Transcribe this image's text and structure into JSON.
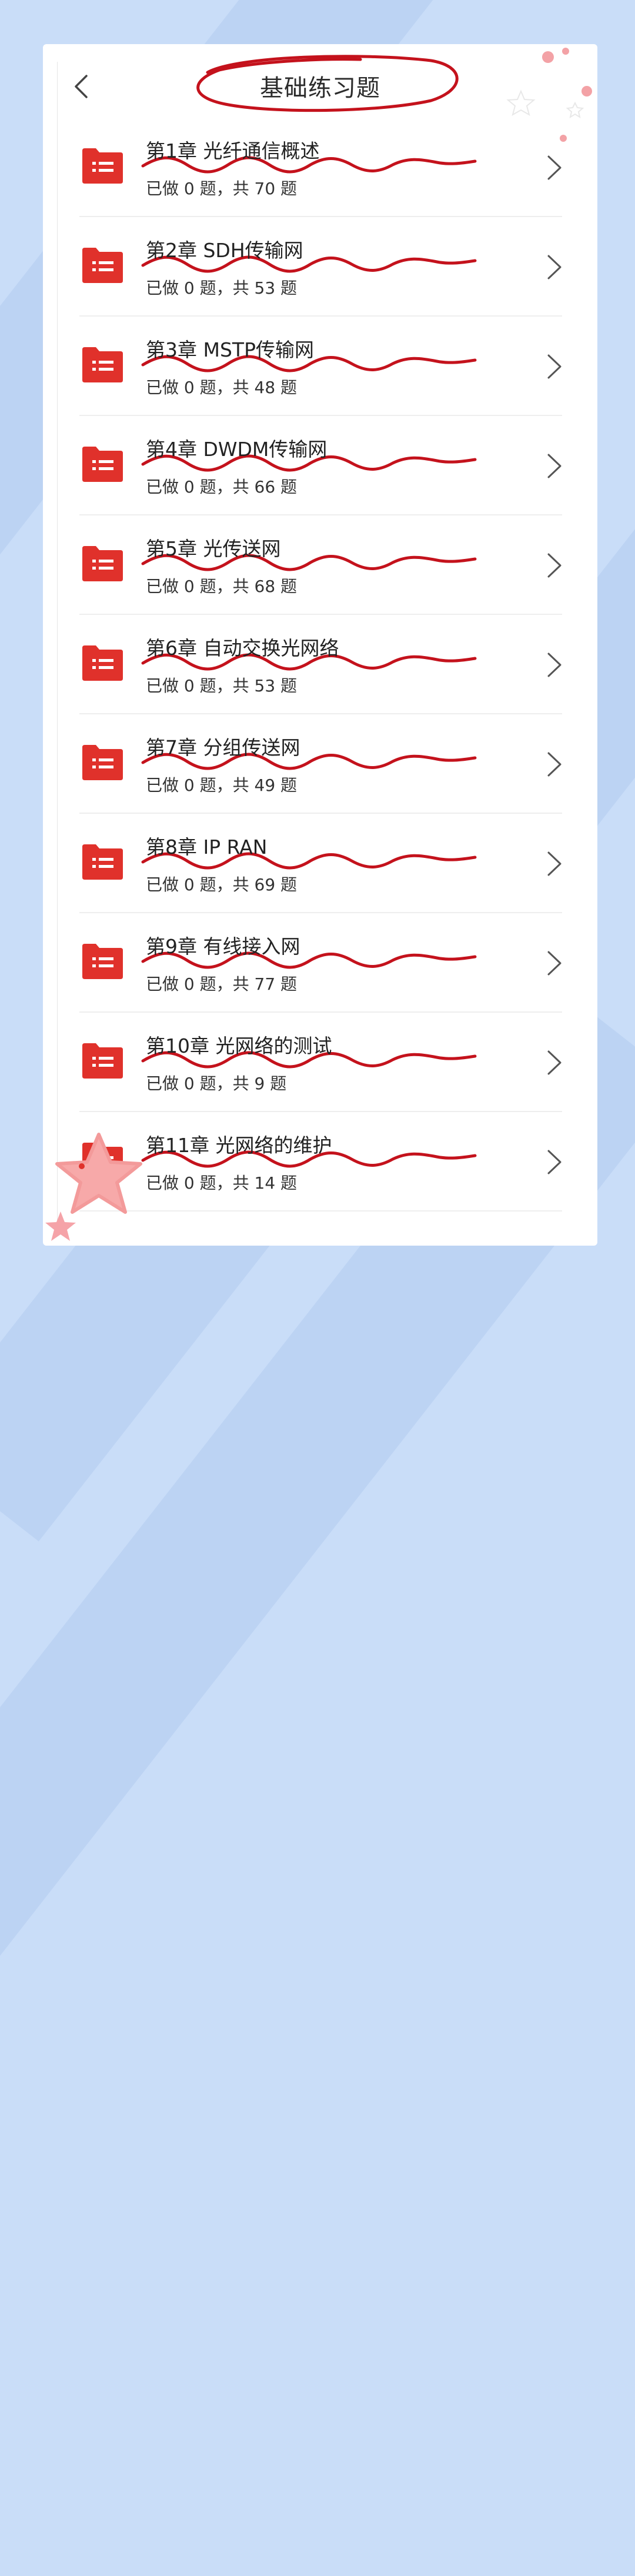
{
  "header": {
    "title": "基础练习题",
    "back_icon": "chevron-left-icon"
  },
  "theme": {
    "accent": "#e0312b",
    "annotation": "#c4121c",
    "background": "#c9ddf8"
  },
  "chapters": [
    {
      "title": "第1章 光纤通信概述",
      "progress": "已做 0 题，共 70 题"
    },
    {
      "title": "第2章 SDH传输网",
      "progress": "已做 0 题，共 53 题"
    },
    {
      "title": "第3章 MSTP传输网",
      "progress": "已做 0 题，共 48 题"
    },
    {
      "title": "第4章 DWDM传输网",
      "progress": "已做 0 题，共 66 题"
    },
    {
      "title": "第5章 光传送网",
      "progress": "已做 0 题，共 68 题"
    },
    {
      "title": "第6章 自动交换光网络",
      "progress": "已做 0 题，共 53 题"
    },
    {
      "title": "第7章 分组传送网",
      "progress": "已做 0 题，共 49 题"
    },
    {
      "title": "第8章 IP RAN",
      "progress": "已做 0 题，共 69 题"
    },
    {
      "title": "第9章 有线接入网",
      "progress": "已做 0 题，共 77 题"
    },
    {
      "title": "第10章 光网络的测试",
      "progress": "已做 0 题，共 9 题"
    },
    {
      "title": "第11章 光网络的维护",
      "progress": "已做 0 题，共 14 题"
    }
  ]
}
